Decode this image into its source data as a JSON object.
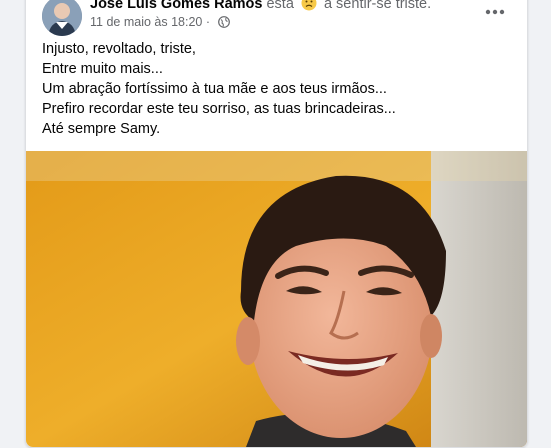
{
  "post": {
    "author": "José Luís Gomes Ramos",
    "feeling_prefix": "está",
    "feeling": "a sentir-se triste.",
    "feeling_icon": "sad-face-icon",
    "timestamp": "11 de maio às 18:20",
    "audience_icon": "globe-icon",
    "more_icon": "more-options-icon",
    "lines": [
      "Injusto, revoltado, triste,",
      "Entre muito mais...",
      "Um abração fortíssimo à tua mãe e aos teus irmãos...",
      "Prefiro recordar este teu sorriso, as tuas brincadeiras...",
      "Até sempre Samy."
    ]
  },
  "colors": {
    "card_bg": "#ffffff",
    "page_bg": "#f0f2f5",
    "text_primary": "#050505",
    "text_secondary": "#65676b",
    "photo_background": "#e8a41c"
  }
}
